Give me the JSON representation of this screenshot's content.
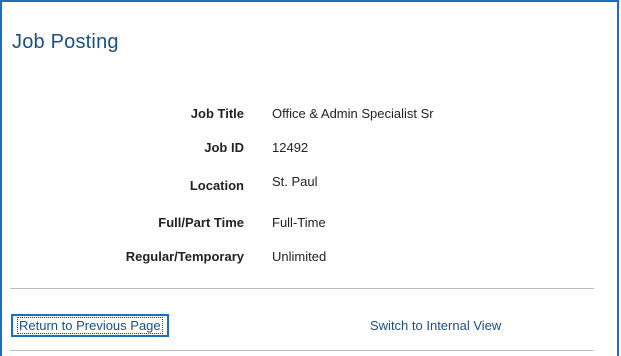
{
  "page": {
    "title": "Job Posting"
  },
  "details": [
    {
      "label": "Job Title",
      "value": "Office & Admin Specialist Sr"
    },
    {
      "label": "Job ID",
      "value": "12492"
    },
    {
      "label": "Location",
      "value": "St. Paul"
    },
    {
      "label": "Full/Part Time",
      "value": "Full-Time"
    },
    {
      "label": "Regular/Temporary",
      "value": "Unlimited"
    }
  ],
  "actions": {
    "return_label": "Return to Previous Page",
    "switch_label": "Switch to Internal View"
  },
  "colors": {
    "accent": "#1c6fb8",
    "title": "#1a4f86",
    "link": "#1a4f86",
    "divider": "#bdbdbd"
  }
}
